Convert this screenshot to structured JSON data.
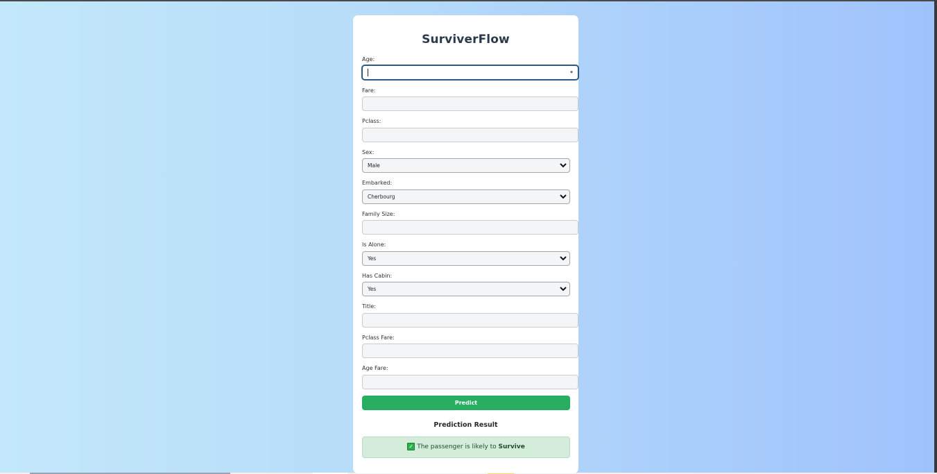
{
  "app": {
    "title": "SurviverFlow"
  },
  "form": {
    "age_label": "Age:",
    "age_value": "",
    "fare_label": "Fare:",
    "pclass_label": "Pclass:",
    "sex_label": "Sex:",
    "sex_value": "Male",
    "embarked_label": "Embarked:",
    "embarked_value": "Cherbourg",
    "family_size_label": "Family Size:",
    "is_alone_label": "Is Alone:",
    "is_alone_value": "Yes",
    "has_cabin_label": "Has Cabin:",
    "has_cabin_value": "Yes",
    "title_label": "Title:",
    "pclass_fare_label": "Pclass Fare:",
    "age_fare_label": "Age Fare:",
    "predict_label": "Predict"
  },
  "result": {
    "heading": "Prediction Result",
    "message_prefix": "The passenger is likely to",
    "message_outcome": "Survive",
    "icon": "check-mark-icon"
  },
  "colors": {
    "primary_button": "#27ae60",
    "result_background": "#d4edda",
    "title_text": "#2a3a4c"
  }
}
